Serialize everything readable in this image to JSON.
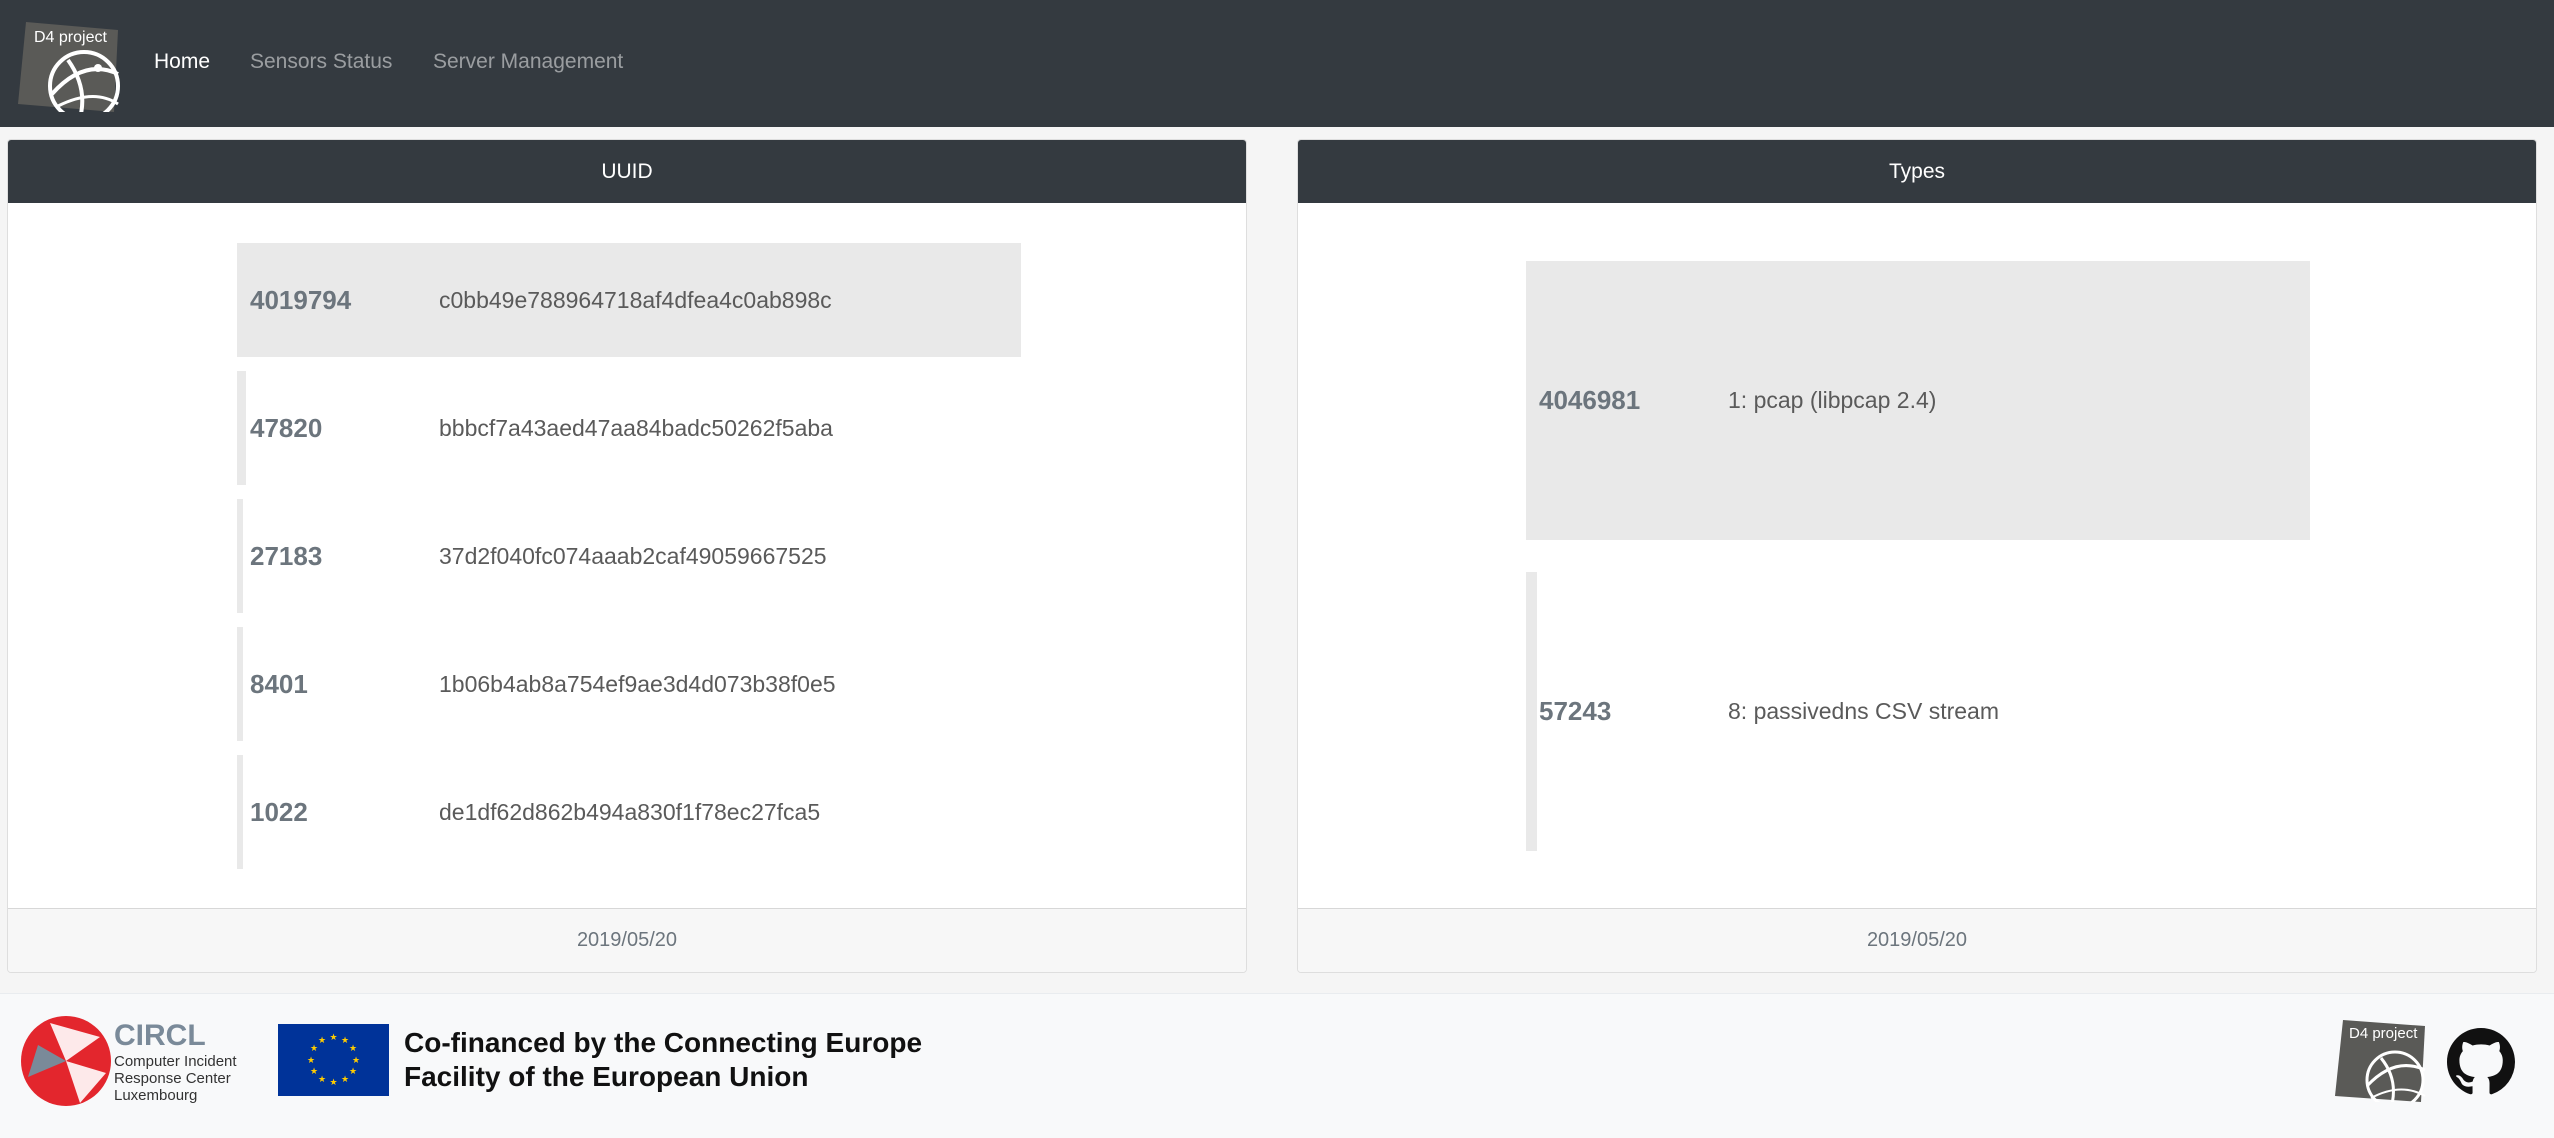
{
  "navbar": {
    "brand_text": "D4 project",
    "links": [
      {
        "label": "Home",
        "active": true
      },
      {
        "label": "Sensors Status",
        "active": false
      },
      {
        "label": "Server Management",
        "active": false
      }
    ]
  },
  "uuid_card": {
    "title": "UUID",
    "date": "2019/05/20",
    "rows": [
      {
        "count": "4019794",
        "uuid": "c0bb49e788964718af4dfea4c0ab898c",
        "share": 1.0
      },
      {
        "count": "47820",
        "uuid": "bbbcf7a43aed47aa84badc50262f5aba",
        "share": 0.0119
      },
      {
        "count": "27183",
        "uuid": "37d2f040fc074aaab2caf49059667525",
        "share": 0.0068
      },
      {
        "count": "8401",
        "uuid": "1b06b4ab8a754ef9ae3d4d073b38f0e5",
        "share": 0.0021
      },
      {
        "count": "1022",
        "uuid": "de1df62d862b494a830f1f78ec27fca5",
        "share": 0.0003
      }
    ]
  },
  "types_card": {
    "title": "Types",
    "date": "2019/05/20",
    "rows": [
      {
        "count": "4046981",
        "type": "1: pcap (libpcap 2.4)",
        "share": 1.0
      },
      {
        "count": "57243",
        "type": "8: passivedns CSV stream",
        "share": 0.0141
      }
    ]
  },
  "footer": {
    "circl_name": "CIRCL",
    "circl_line1": "Computer Incident",
    "circl_line2": "Response Center",
    "circl_line3": "Luxembourg",
    "cofinance_line1": "Co-financed by the Connecting Europe",
    "cofinance_line2": "Facility of the European Union",
    "d4_text": "D4 project"
  },
  "colors": {
    "navbar": "#343a40",
    "bar": "#e9e9e9",
    "circl_red": "#e3262d",
    "circl_grey": "#7a8a99",
    "eu_blue": "#003399",
    "eu_star": "#ffcc00"
  }
}
